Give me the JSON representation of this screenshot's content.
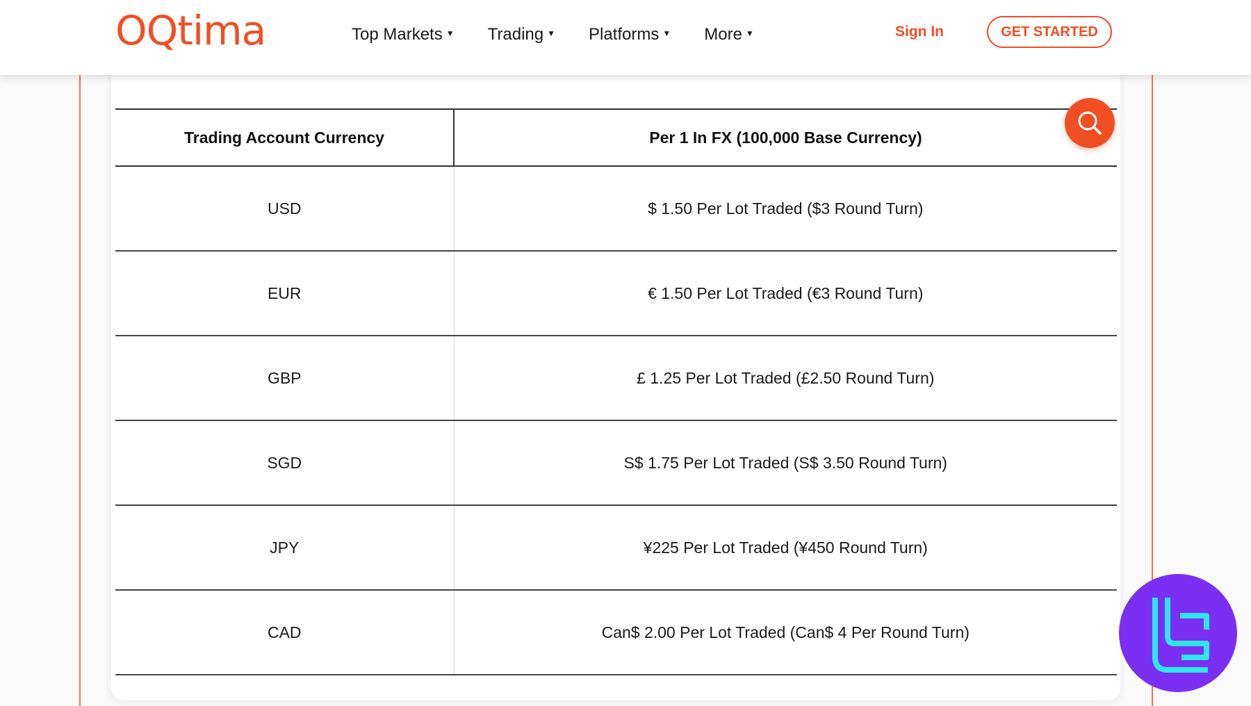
{
  "header": {
    "logo_text": "OQtima",
    "nav": [
      {
        "label": "Top Markets"
      },
      {
        "label": "Trading"
      },
      {
        "label": "Platforms"
      },
      {
        "label": "More"
      }
    ],
    "sign_in_label": "Sign In",
    "get_started_label": "GET STARTED"
  },
  "table": {
    "headers": [
      "Trading Account Currency",
      "Per 1 In FX (100,000 Base Currency)"
    ],
    "rows": [
      [
        "USD",
        "$ 1.50 Per Lot Traded ($3 Round Turn)"
      ],
      [
        "EUR",
        "€ 1.50 Per Lot Traded (€3 Round Turn)"
      ],
      [
        "GBP",
        "£ 1.25 Per Lot Traded (£2.50 Round Turn)"
      ],
      [
        "SGD",
        "S$ 1.75 Per Lot Traded (S$ 3.50 Round Turn)"
      ],
      [
        "JPY",
        "¥225 Per Lot Traded (¥450 Round Turn)"
      ],
      [
        "CAD",
        "Can$ 2.00 Per Lot Traded (Can$ 4 Per Round Turn)"
      ]
    ]
  },
  "icons": {
    "search": "search-icon",
    "badge": "brand-badge-icon",
    "caret": "caret-down-icon"
  },
  "colors": {
    "accent": "#f04e23",
    "badge_bg": "#7b2ff2",
    "badge_fg": "#2ee6f0"
  }
}
